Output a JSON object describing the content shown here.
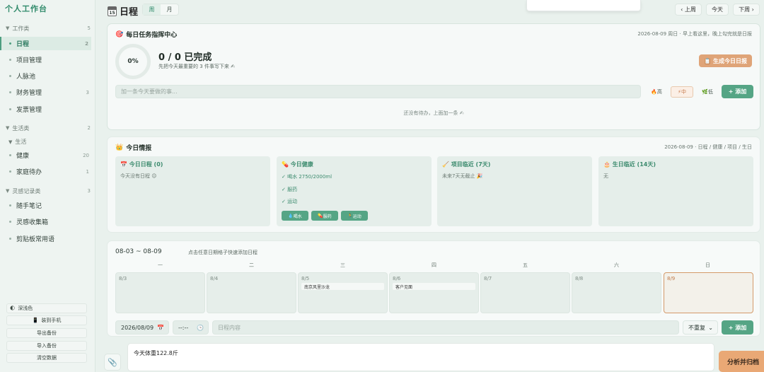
{
  "sidebar": {
    "logo": "个人工作台",
    "groups": {
      "work": {
        "label": "工作类",
        "count": "5"
      },
      "life": {
        "label": "生活类",
        "count": "2"
      },
      "life_sub": {
        "label": "生活"
      },
      "inspire": {
        "label": "灵感记录类",
        "count": "3"
      }
    },
    "items": [
      {
        "label": "日程",
        "count": "2"
      },
      {
        "label": "项目管理",
        "count": ""
      },
      {
        "label": "人脉池",
        "count": ""
      },
      {
        "label": "财务管理",
        "count": "3"
      },
      {
        "label": "发票管理",
        "count": ""
      },
      {
        "label": "健康",
        "count": "20"
      },
      {
        "label": "家庭待办",
        "count": "1"
      },
      {
        "label": "随手笔记",
        "count": ""
      },
      {
        "label": "灵感收集箱",
        "count": ""
      },
      {
        "label": "剪贴板常用语",
        "count": ""
      }
    ],
    "buttons": {
      "theme": "深浅色",
      "mobile": "装到手机",
      "export": "导出备份",
      "import": "导入备份",
      "clear": "清空数据"
    }
  },
  "header": {
    "title": "日程",
    "cal_day": "15",
    "view_week": "周",
    "view_month": "月",
    "prev": "‹ 上周",
    "today": "今天",
    "next": "下周 ›"
  },
  "task_card": {
    "title": "每日任务指挥中心",
    "meta": "2026-08-09 周日 · 早上看这里，晚上勾完就是日报",
    "progress": "0%",
    "done_text": "0 / 0 已完成",
    "hint": "先把今天最重要的 3 件事写下来 ✍",
    "gen_report": "生成今日日报",
    "input_placeholder": "加一条今天要做的事...",
    "prio_high": "高",
    "prio_mid": "中",
    "prio_low": "低",
    "add": "+ 添加",
    "empty": "还没有待办，上面加一条 ✍"
  },
  "intel_card": {
    "title": "今日情报",
    "meta": "2026-08-09 · 日程 / 健康 / 项目 / 生日",
    "schedule": {
      "title": "今日日程 (0)",
      "text": "今天没有日程 😌"
    },
    "health": {
      "title": "今日健康",
      "checks": [
        "✓ 喝水 2750/2000ml",
        "✓ 服药",
        "✓ 运动"
      ],
      "pills": [
        "喝水",
        "服药",
        "运动"
      ]
    },
    "project": {
      "title": "项目临近 (7天)",
      "text": "未来7天无截止 🎉"
    },
    "birthday": {
      "title": "生日临近 (14天)",
      "text": "无"
    }
  },
  "week_card": {
    "range": "08-03 ~ 08-09",
    "tip": "点击任意日期格子快速添加日程",
    "weekdays": [
      "一",
      "二",
      "三",
      "四",
      "五",
      "六",
      "日"
    ],
    "days": [
      {
        "date": "8/3",
        "event": ""
      },
      {
        "date": "8/4",
        "event": ""
      },
      {
        "date": "8/5",
        "event": "南京风里沙龙"
      },
      {
        "date": "8/6",
        "event": "客户见面"
      },
      {
        "date": "8/7",
        "event": ""
      },
      {
        "date": "8/8",
        "event": ""
      },
      {
        "date": "8/9",
        "event": ""
      }
    ],
    "date_value": "2026/08/09",
    "time_value": "--:--",
    "content_placeholder": "日程内容",
    "repeat": "不重复",
    "add": "+ 添加"
  },
  "bottom": {
    "input_value": "今天体重122.8斤",
    "analyze": "分析并归档"
  }
}
